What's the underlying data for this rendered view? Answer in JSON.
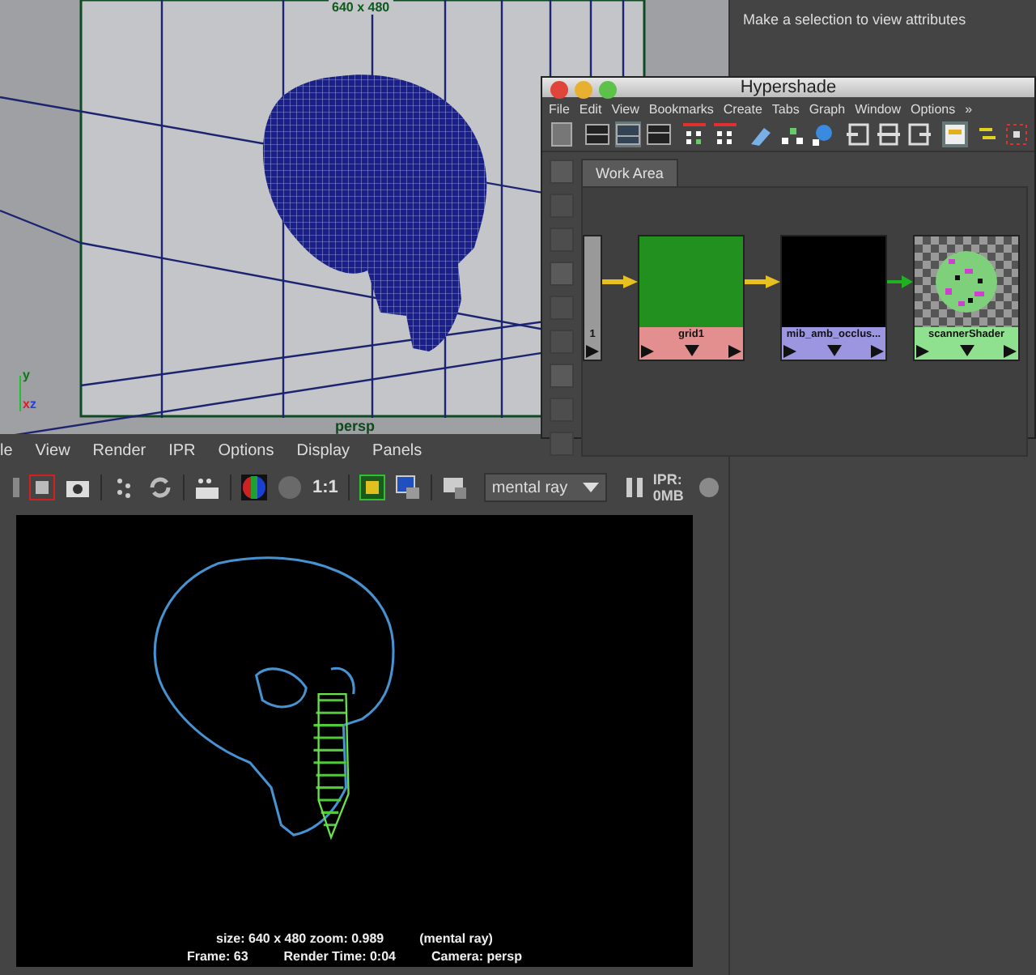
{
  "viewport": {
    "resolution_label": "640 x 480",
    "camera_label": "persp",
    "axis": [
      "y",
      "x",
      "z"
    ]
  },
  "attribute_editor": {
    "message": "Make a selection to view attributes"
  },
  "hypershade": {
    "title": "Hypershade",
    "menu": [
      "File",
      "Edit",
      "View",
      "Bookmarks",
      "Create",
      "Tabs",
      "Graph",
      "Window",
      "Options",
      "»"
    ],
    "tabs": [
      {
        "label": "Work Area",
        "selected": true
      }
    ],
    "nodes": [
      {
        "label": "1",
        "kind": "partial",
        "color": "#9a9a9a"
      },
      {
        "label": "grid1",
        "kind": "texture",
        "color": "#e48f8f"
      },
      {
        "label": "mib_amb_occlus...",
        "kind": "black",
        "color": "#9c96e0"
      },
      {
        "label": "scannerShader",
        "kind": "shader",
        "color": "#8fe08f"
      }
    ]
  },
  "render_view": {
    "menu": [
      "le",
      "View",
      "Render",
      "IPR",
      "Options",
      "Display",
      "Panels"
    ],
    "ratio_label": "1:1",
    "renderer": {
      "value": "mental ray"
    },
    "ipr": "IPR: 0MB",
    "info": [
      [
        "size: 640 x 480 zoom: 0.989",
        "(mental ray)"
      ],
      [
        "Frame: 63",
        "Render Time: 0:04",
        "Camera: persp"
      ]
    ]
  }
}
